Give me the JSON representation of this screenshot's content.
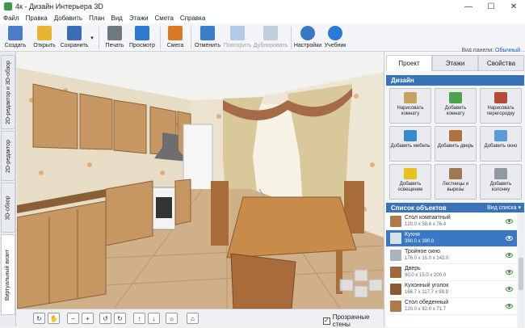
{
  "window": {
    "title": "4к - Дизайн Интерьера 3D"
  },
  "menu": [
    "Файл",
    "Правка",
    "Добавить",
    "План",
    "Вид",
    "Этажи",
    "Смета",
    "Справка"
  ],
  "toolbar": {
    "items": [
      {
        "label": "Создать",
        "icon": "new-doc-icon",
        "color": "#4a7cc8"
      },
      {
        "label": "Открыть",
        "icon": "folder-icon",
        "color": "#e8b530"
      },
      {
        "label": "Сохранить",
        "icon": "floppy-icon",
        "color": "#3a6cb8"
      },
      {
        "label": "Печать",
        "icon": "printer-icon",
        "color": "#707880"
      },
      {
        "label": "Просмотр",
        "icon": "monitor-icon",
        "color": "#2b7ad0"
      },
      {
        "label": "Смета",
        "icon": "estimate-icon",
        "color": "#d87a28"
      },
      {
        "label": "Отменить",
        "icon": "undo-icon",
        "color": "#3b7dc8"
      },
      {
        "label": "Повторить",
        "icon": "redo-icon",
        "color": "#3b7dc8"
      },
      {
        "label": "Дублировать",
        "icon": "duplicate-icon",
        "color": "#7088a8"
      },
      {
        "label": "Настройки",
        "icon": "gear-icon",
        "color": "#3a78c6"
      },
      {
        "label": "Учебник",
        "icon": "help-icon",
        "color": "#2a7ad8"
      }
    ],
    "view_panel_label": "Вид панели:",
    "view_panel_value": "Обычный"
  },
  "side_tabs": [
    "2D-редактор и 3D-обзор",
    "2D-редактор",
    "3D-обзор",
    "Виртуальный визит"
  ],
  "scene": {
    "colors": {
      "wall": "#e7dcc5",
      "floor": "#cfb089",
      "cabinet": "#c69663",
      "curtain": "#d9c89a"
    }
  },
  "bottom_bar": {
    "transparent_walls_label": "Прозрачные стены",
    "transparent_walls_checked": "✓"
  },
  "right_panel": {
    "tabs": [
      "Проект",
      "Этажи",
      "Свойства"
    ],
    "design_header": "Дизайн",
    "design_buttons": [
      {
        "label": "Нарисовать комнату",
        "icon": "draw-room-icon",
        "color": "#c8a060"
      },
      {
        "label": "Добавить комнату",
        "icon": "add-room-icon",
        "color": "#4aa24a"
      },
      {
        "label": "Нарисовать перегородку",
        "icon": "draw-wall-icon",
        "color": "#b84a3a"
      },
      {
        "label": "Добавить мебель",
        "icon": "furniture-icon",
        "color": "#3a8ad0"
      },
      {
        "label": "Добавить дверь",
        "icon": "door-icon",
        "color": "#b07040"
      },
      {
        "label": "Добавить окно",
        "icon": "window-icon",
        "color": "#5a9ad8"
      },
      {
        "label": "Добавить освещение",
        "icon": "lamp-icon",
        "color": "#e8c020"
      },
      {
        "label": "Лестницы и вырезы",
        "icon": "stairs-icon",
        "color": "#a07850"
      },
      {
        "label": "Добавить колонну",
        "icon": "column-icon",
        "color": "#9098a0"
      }
    ],
    "object_list_header": "Список объектов",
    "object_list_view": "Вид списка",
    "objects": [
      {
        "name": "Стол компактный",
        "size": "120.0 x 58.6 x 76.4",
        "color": "#b07a48",
        "selected": false
      },
      {
        "name": "Кухня",
        "size": "390.0 x 390.0",
        "color": "#d8e0e8",
        "selected": true
      },
      {
        "name": "Тройное окно",
        "size": "176.0 x 15.0 x 142.0",
        "color": "#a8b4c0",
        "selected": false
      },
      {
        "name": "Дверь",
        "size": "90.0 x 15.0 x 200.0",
        "color": "#a06838",
        "selected": false
      },
      {
        "name": "Кухонный уголок",
        "size": "166.7 x 117.7 x 99.9",
        "color": "#8a5a30",
        "selected": false
      },
      {
        "name": "Стол обеденный",
        "size": "120.0 x 82.0 x 71.7",
        "color": "#b07a48",
        "selected": false
      }
    ]
  }
}
